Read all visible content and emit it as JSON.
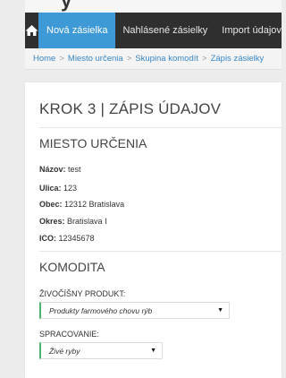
{
  "nav": {
    "items": [
      "Nová zásielka",
      "Nahlásené zásielky",
      "Import údajov"
    ]
  },
  "breadcrumb": [
    "Home",
    "Miesto určenia",
    "Skupina komodít",
    "Zápis zásielky"
  ],
  "step_title": "KROK 3 | ZÁPIS ÚDAJOV",
  "destination": {
    "title": "MIESTO URČENIA",
    "fields": [
      {
        "label": "Názov:",
        "value": "test"
      },
      {
        "label": "Ulica:",
        "value": "123"
      },
      {
        "label": "Obec:",
        "value": "12312 Bratislava"
      },
      {
        "label": "Okres:",
        "value": "Bratislava I"
      },
      {
        "label": "ICO:",
        "value": "12345678"
      }
    ]
  },
  "commodity": {
    "title": "KOMODITA",
    "product_label": "ŽIVOČÍŠNY PRODUKT:",
    "product_value": "Produkty farmového chovu rýb",
    "processing_label": "SPRACOVANIE:",
    "processing_value": "Živé ryby"
  },
  "colors": {
    "nav_bg": "#2f2f2f",
    "nav_active": "#3d9ad6",
    "link": "#3a87c4",
    "select_accent": "#4db36a"
  }
}
